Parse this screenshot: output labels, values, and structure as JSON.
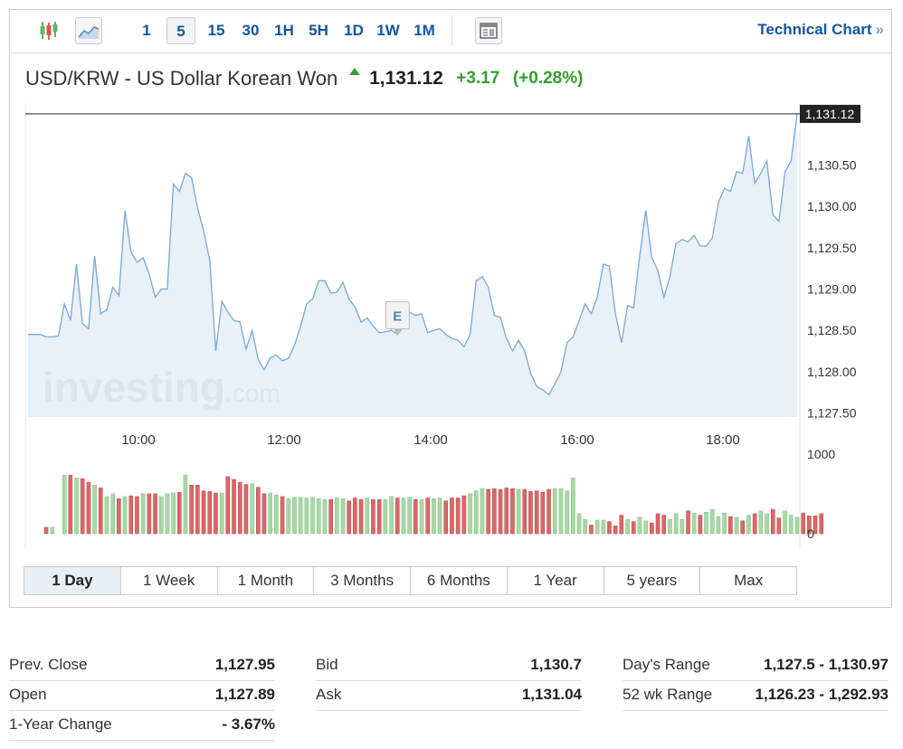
{
  "toolbar": {
    "candle_icon": "candlestick-icon",
    "line_icon": "line-chart-icon",
    "intervals": [
      {
        "label": "1",
        "active": false
      },
      {
        "label": "5",
        "active": true
      },
      {
        "label": "15",
        "active": false
      },
      {
        "label": "30",
        "active": false
      },
      {
        "label": "1H",
        "active": false
      },
      {
        "label": "5H",
        "active": false
      },
      {
        "label": "1D",
        "active": false
      },
      {
        "label": "1W",
        "active": false
      },
      {
        "label": "1M",
        "active": false
      }
    ],
    "news_icon": "news-icon",
    "technical_chart": "Technical Chart",
    "chevron": "»"
  },
  "header": {
    "pair_name": "USD/KRW - US Dollar Korean Won",
    "last_price": "1,131.12",
    "change": "+3.17",
    "change_pct": "(+0.28%)",
    "direction": "up"
  },
  "chart_data": {
    "type": "area",
    "x_ticks": [
      "10:00",
      "12:00",
      "14:00",
      "16:00",
      "18:00"
    ],
    "y_ticks": [
      "1,130.50",
      "1,130.00",
      "1,129.50",
      "1,129.00",
      "1,128.50",
      "1,128.00",
      "1,127.50"
    ],
    "y_tick_values": [
      1130.5,
      1130.0,
      1129.5,
      1129.0,
      1128.5,
      1128.0,
      1127.5
    ],
    "ylim": [
      1127.45,
      1131.25
    ],
    "last_label": "1,131.12",
    "last_value": 1131.12,
    "event_marker": "E",
    "event_index": 61,
    "watermark": "investing",
    "watermark_suffix": ".com",
    "volume_axis": [
      "1000",
      "0"
    ],
    "volume_max": 1000,
    "colors": {
      "line": "#7aa8d4",
      "fill": "#e6eef7",
      "up": "#a8d8a8",
      "down": "#d9686a"
    },
    "prices": [
      1128.45,
      1128.45,
      1128.45,
      1128.42,
      1128.42,
      1128.43,
      1128.82,
      1128.62,
      1129.3,
      1128.58,
      1128.52,
      1129.4,
      1128.7,
      1128.75,
      1129.02,
      1128.92,
      1129.95,
      1129.45,
      1129.32,
      1129.38,
      1129.18,
      1128.9,
      1129.0,
      1129.0,
      1130.27,
      1130.18,
      1130.4,
      1130.35,
      1129.98,
      1129.7,
      1129.35,
      1128.25,
      1128.85,
      1128.72,
      1128.62,
      1128.6,
      1128.27,
      1128.5,
      1128.15,
      1128.02,
      1128.17,
      1128.2,
      1128.13,
      1128.16,
      1128.32,
      1128.55,
      1128.82,
      1128.88,
      1129.1,
      1129.1,
      1128.95,
      1128.96,
      1129.08,
      1128.88,
      1128.78,
      1128.6,
      1128.65,
      1128.55,
      1128.47,
      1128.48,
      1128.5,
      1128.45,
      1128.55,
      1128.72,
      1128.68,
      1128.7,
      1128.47,
      1128.5,
      1128.52,
      1128.45,
      1128.4,
      1128.38,
      1128.3,
      1128.45,
      1129.1,
      1129.15,
      1129.02,
      1128.68,
      1128.66,
      1128.4,
      1128.25,
      1128.38,
      1128.25,
      1127.98,
      1127.82,
      1127.78,
      1127.72,
      1127.85,
      1128.0,
      1128.35,
      1128.42,
      1128.62,
      1128.82,
      1128.7,
      1128.9,
      1129.3,
      1129.28,
      1128.7,
      1128.35,
      1128.8,
      1128.77,
      1129.4,
      1129.95,
      1129.38,
      1129.22,
      1128.9,
      1129.15,
      1129.55,
      1129.6,
      1129.57,
      1129.65,
      1129.52,
      1129.52,
      1129.62,
      1130.05,
      1130.22,
      1130.18,
      1130.42,
      1130.4,
      1130.85,
      1130.28,
      1130.4,
      1130.55,
      1129.9,
      1129.82,
      1130.42,
      1130.55,
      1131.12
    ],
    "volumes": [
      null,
      null,
      null,
      90,
      90,
      null,
      820,
      820,
      780,
      770,
      720,
      680,
      640,
      520,
      560,
      490,
      520,
      530,
      520,
      560,
      560,
      560,
      520,
      560,
      570,
      580,
      820,
      680,
      680,
      600,
      590,
      570,
      570,
      800,
      760,
      720,
      690,
      700,
      650,
      560,
      570,
      540,
      520,
      490,
      510,
      510,
      500,
      510,
      490,
      480,
      480,
      500,
      490,
      460,
      500,
      480,
      500,
      480,
      480,
      480,
      520,
      500,
      500,
      510,
      480,
      480,
      500,
      490,
      500,
      460,
      500,
      500,
      530,
      560,
      600,
      630,
      620,
      630,
      620,
      640,
      630,
      620,
      620,
      590,
      600,
      580,
      620,
      630,
      630,
      600,
      780,
      280,
      200,
      120,
      190,
      190,
      170,
      110,
      260,
      200,
      170,
      230,
      180,
      150,
      280,
      260,
      200,
      280,
      200,
      320,
      290,
      260,
      300,
      340,
      240,
      290,
      240,
      230,
      180,
      260,
      280,
      320,
      280,
      340,
      220,
      320,
      260,
      230,
      290,
      250,
      250,
      280
    ]
  },
  "timeframes": [
    {
      "label": "1 Day",
      "active": true
    },
    {
      "label": "1 Week",
      "active": false
    },
    {
      "label": "1 Month",
      "active": false
    },
    {
      "label": "3 Months",
      "active": false
    },
    {
      "label": "6 Months",
      "active": false
    },
    {
      "label": "1 Year",
      "active": false
    },
    {
      "label": "5 years",
      "active": false
    },
    {
      "label": "Max",
      "active": false
    }
  ],
  "stats": {
    "col1": [
      {
        "k": "Prev. Close",
        "v": "1,127.95"
      },
      {
        "k": "Open",
        "v": "1,127.89"
      },
      {
        "k": "1-Year Change",
        "v": "- 3.67%"
      }
    ],
    "col2": [
      {
        "k": "Bid",
        "v": "1,130.7"
      },
      {
        "k": "Ask",
        "v": "1,131.04"
      }
    ],
    "col3": [
      {
        "k": "Day's Range",
        "v": "1,127.5 - 1,130.97"
      },
      {
        "k": "52 wk Range",
        "v": "1,126.23 - 1,292.93"
      }
    ]
  }
}
